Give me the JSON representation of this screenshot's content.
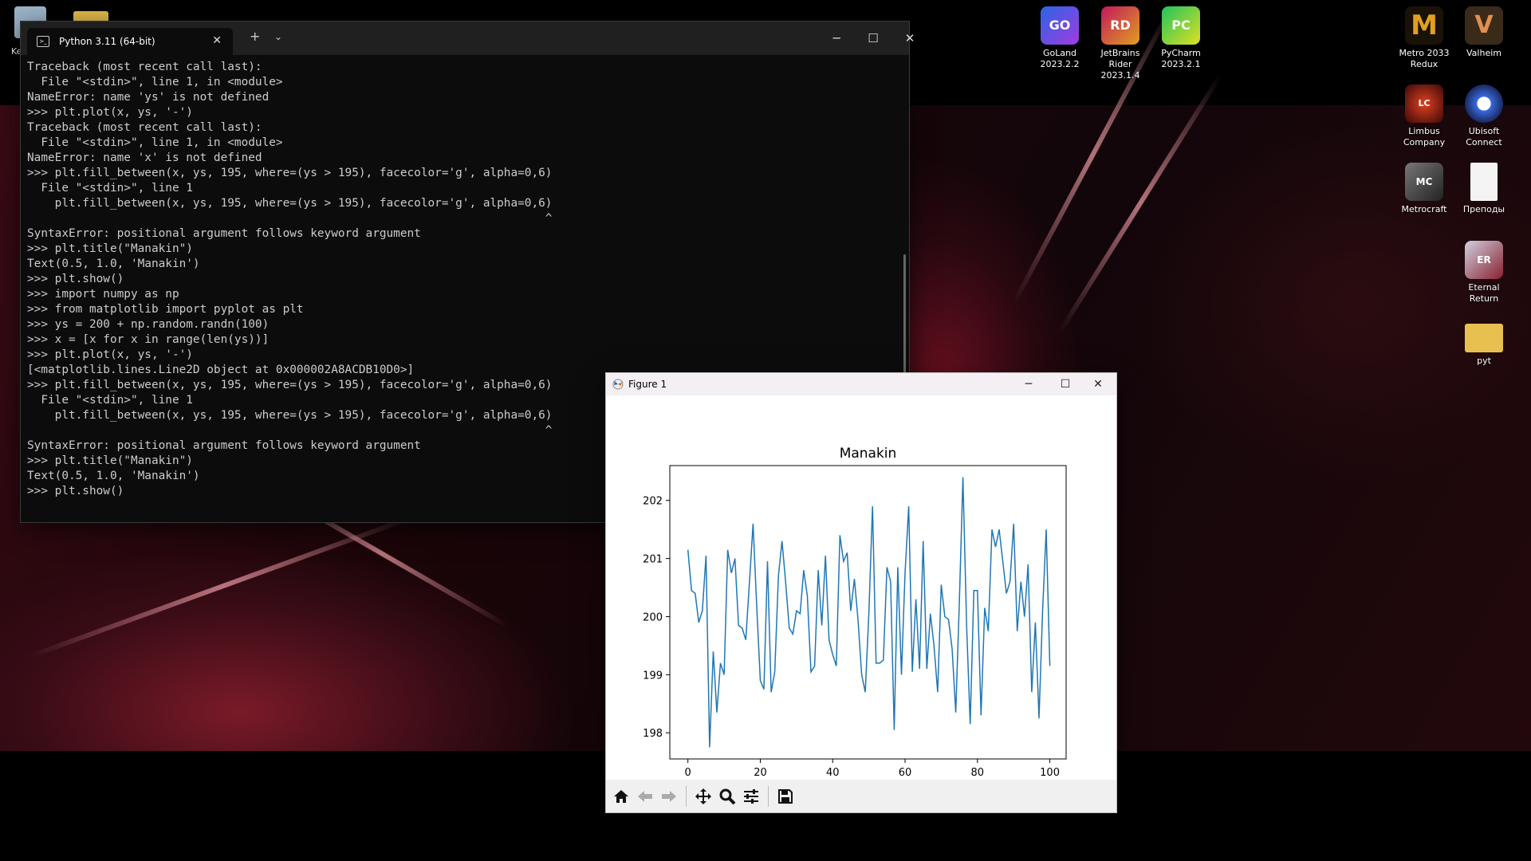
{
  "desktop": {
    "icons": [
      {
        "label": "GoLand 2023.2.2",
        "short": "GO",
        "color": "#2a64e6"
      },
      {
        "label": "JetBrains Rider 2023.1.4",
        "short": "RD",
        "color": "#c2185b"
      },
      {
        "label": "PyCharm 2023.2.1",
        "short": "PC",
        "color": "#21c35e"
      },
      {
        "label": "Metro 2033 Redux",
        "short": "M",
        "color": "#c08a1a"
      },
      {
        "label": "Valheim",
        "short": "V",
        "color": "#6b4a2a"
      },
      {
        "label": "Limbus Company",
        "short": "LC",
        "color": "#7a1010"
      },
      {
        "label": "Ubisoft Connect",
        "short": "U",
        "color": "#2a4aa0"
      },
      {
        "label": "Metrocraft",
        "short": "MC",
        "color": "#444444"
      },
      {
        "label": "Преподы",
        "short": "",
        "color": "#e8e8e8"
      },
      {
        "label": "Eternal Return",
        "short": "ER",
        "color": "#8a2030"
      },
      {
        "label": "pyt",
        "short": "",
        "color": "#e8c050"
      }
    ],
    "partial_label": "Ke"
  },
  "terminal": {
    "tab_title": "Python 3.11 (64-bit)",
    "lines": [
      "Traceback (most recent call last):",
      "  File \"<stdin>\", line 1, in <module>",
      "NameError: name 'ys' is not defined",
      ">>> plt.plot(x, ys, '-')",
      "Traceback (most recent call last):",
      "  File \"<stdin>\", line 1, in <module>",
      "NameError: name 'x' is not defined",
      ">>> plt.fill_between(x, ys, 195, where=(ys > 195), facecolor='g', alpha=0,6)",
      "  File \"<stdin>\", line 1",
      "    plt.fill_between(x, ys, 195, where=(ys > 195), facecolor='g', alpha=0,6)",
      "                                                                           ^",
      "SyntaxError: positional argument follows keyword argument",
      ">>> plt.title(\"Manakin\")",
      "Text(0.5, 1.0, 'Manakin')",
      ">>> plt.show()",
      ">>> import numpy as np",
      ">>> from matplotlib import pyplot as plt",
      ">>> ys = 200 + np.random.randn(100)",
      ">>> x = [x for x in range(len(ys))]",
      ">>> plt.plot(x, ys, '-')",
      "[<matplotlib.lines.Line2D object at 0x000002A8ACDB10D0>]",
      ">>> plt.fill_between(x, ys, 195, where=(ys > 195), facecolor='g', alpha=0,6)",
      "  File \"<stdin>\", line 1",
      "    plt.fill_between(x, ys, 195, where=(ys > 195), facecolor='g', alpha=0,6)",
      "                                                                           ^",
      "SyntaxError: positional argument follows keyword argument",
      ">>> plt.title(\"Manakin\")",
      "Text(0.5, 1.0, 'Manakin')",
      ">>> plt.show()"
    ]
  },
  "figure": {
    "window_title": "Figure 1",
    "chart_data": {
      "type": "line",
      "title": "Manakin",
      "xlabel": "",
      "ylabel": "",
      "xlim": [
        -5,
        104.5
      ],
      "ylim": [
        197.55,
        202.6
      ],
      "xticks": [
        0,
        20,
        40,
        60,
        80,
        100
      ],
      "yticks": [
        198,
        199,
        200,
        201,
        202
      ],
      "line_color": "#1f77b4",
      "y": [
        201.15,
        200.45,
        200.4,
        199.9,
        200.1,
        201.05,
        197.75,
        199.4,
        198.35,
        199.2,
        199.0,
        201.15,
        200.75,
        201.0,
        199.85,
        199.8,
        199.6,
        200.6,
        201.6,
        200.2,
        198.9,
        198.75,
        200.95,
        198.7,
        199.05,
        200.7,
        201.3,
        200.6,
        199.8,
        199.7,
        200.1,
        200.05,
        200.8,
        200.35,
        199.05,
        199.15,
        200.8,
        199.85,
        201.05,
        199.6,
        199.35,
        199.15,
        201.4,
        200.95,
        201.1,
        200.1,
        200.65,
        199.95,
        199.0,
        198.7,
        200.05,
        201.9,
        199.2,
        199.2,
        199.25,
        200.85,
        200.6,
        198.05,
        200.85,
        199.0,
        200.75,
        201.9,
        199.05,
        200.3,
        199.1,
        201.3,
        199.1,
        200.05,
        199.5,
        198.7,
        200.55,
        200.0,
        199.95,
        199.45,
        198.35,
        200.25,
        202.4,
        199.85,
        198.15,
        200.45,
        200.45,
        198.3,
        200.15,
        199.75,
        201.5,
        201.2,
        201.5,
        200.95,
        200.4,
        200.6,
        201.6,
        199.75,
        200.6,
        200.0,
        200.9,
        198.7,
        199.9,
        198.25,
        200.1,
        201.5,
        199.15
      ]
    },
    "toolbar": [
      "home-icon",
      "back-icon",
      "forward-icon",
      "pan-icon",
      "zoom-icon",
      "configure-icon",
      "save-icon"
    ]
  }
}
